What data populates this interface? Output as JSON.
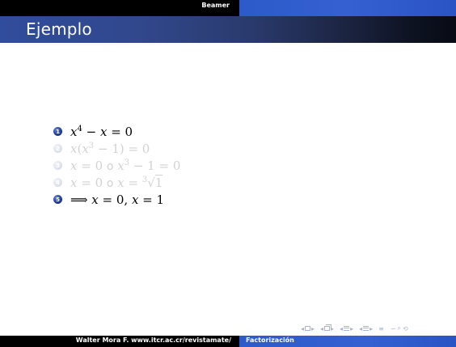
{
  "headline": {
    "left_text": "Beamer"
  },
  "frame": {
    "title": "Ejemplo"
  },
  "steps": [
    {
      "number": "1",
      "state": "active"
    },
    {
      "number": "2",
      "state": "faded"
    },
    {
      "number": "3",
      "state": "faded"
    },
    {
      "number": "4",
      "state": "faded"
    },
    {
      "number": "5",
      "state": "active"
    }
  ],
  "math_text": {
    "step1": {
      "x": "x",
      "exp": "4",
      "rest": " − ",
      "x2": "x",
      "eq": " = 0"
    },
    "step2": {
      "x": "x",
      "open": "(",
      "x2": "x",
      "exp": "3",
      "rest": " − 1) = 0"
    },
    "step3": {
      "a": "x",
      "eqa": " = 0 ",
      "o": "o",
      "b": " x",
      "exp": "3",
      "rest": " − 1 = 0"
    },
    "step4": {
      "a": "x",
      "eqa": " = 0 ",
      "o": "o",
      "b": " x",
      "eqb": " = ",
      "root_index": "3",
      "root": "√",
      "radicand": "1"
    },
    "step5": {
      "implies": "⟹ ",
      "a": "x",
      "eqa": " = 0, ",
      "b": "x",
      "eqb": " = 1"
    }
  },
  "footer": {
    "author": "Walter Mora F. www.itcr.ac.cr/revistamate/",
    "section": "Factorización"
  },
  "nav": {
    "prev": "◂",
    "next": "▸",
    "align": "≡",
    "search": "∽",
    "zoom_out": "⌕",
    "zoom_in": "⟲"
  },
  "colors": {
    "headline_right": "#2c5bc9",
    "title_bar_start": "#304c9c",
    "title_bar_end": "#080b14",
    "active_ball": "#2a47a8",
    "faded_text": "#d2d2d2",
    "nav_symbols": "#a9b3d1"
  }
}
